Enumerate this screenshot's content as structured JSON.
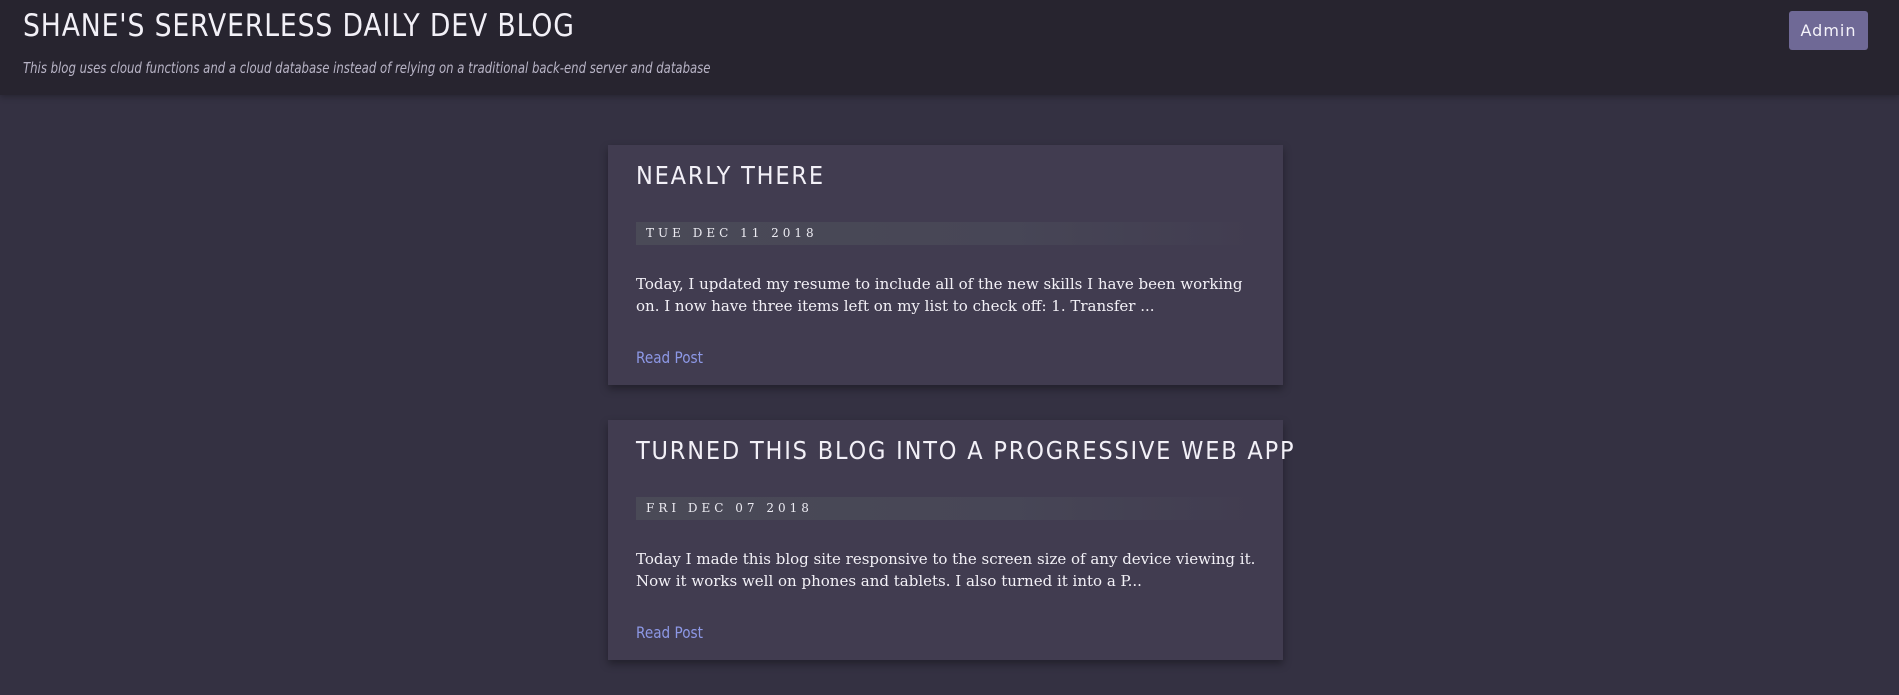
{
  "header": {
    "title": "SHANE'S SERVERLESS DAILY DEV BLOG",
    "subtitle": "This blog uses cloud functions and a cloud database instead of relying on a traditional back-end server and database",
    "admin_label": "Admin"
  },
  "posts": [
    {
      "title": "NEARLY THERE",
      "date": "TUE DEC 11 2018",
      "excerpt": "Today, I updated my resume to include all of the new skills I have been working on. I now have three items left on my list to check off: 1. Transfer ...",
      "link_label": "Read Post"
    },
    {
      "title": "TURNED THIS BLOG INTO A PROGRESSIVE WEB APP",
      "date": "FRI DEC 07 2018",
      "excerpt": "Today I made this blog site responsive to the screen size of any device viewing it. Now it works well on phones and tablets. I also turned it into a P...",
      "link_label": "Read Post"
    }
  ],
  "colors": {
    "page_background": "#343142",
    "header_background": "#27242f",
    "card_background": "#413c50",
    "admin_button": "#6f6996",
    "link": "#8d98e6"
  }
}
